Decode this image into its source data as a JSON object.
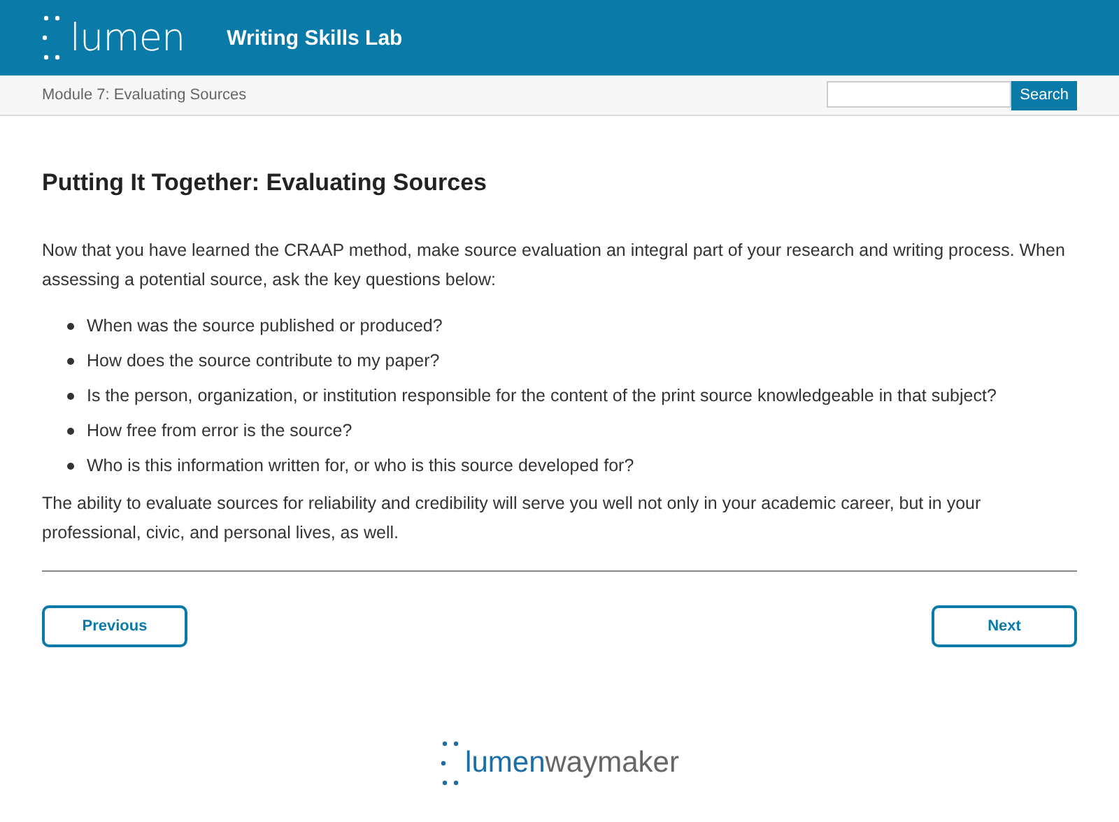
{
  "header": {
    "logo": "lumen",
    "title": "Writing Skills Lab"
  },
  "breadcrumb": {
    "module": "Module 7: Evaluating Sources",
    "search_button": "Search"
  },
  "article": {
    "heading": "Putting It Together: Evaluating Sources",
    "intro": "Now that you have learned the CRAAP method, make source evaluation an integral part of your research and writing process.  When assessing a potential source, ask the key questions below:",
    "questions": [
      "When was the source published or produced?",
      "How does the source contribute to my paper?",
      "Is the person, organization, or institution responsible for the content of the print source knowledgeable in that subject?",
      "How free from error is the source?",
      "Who is this information written for, or who is this source developed for?"
    ],
    "closing": "The ability to evaluate sources for reliability and credibility will serve you well not only in your academic career, but in your professional, civic, and personal lives, as well."
  },
  "nav": {
    "previous": "Previous",
    "next": "Next"
  },
  "footer": {
    "logo_left": "lumen",
    "logo_right": "waymaker"
  }
}
